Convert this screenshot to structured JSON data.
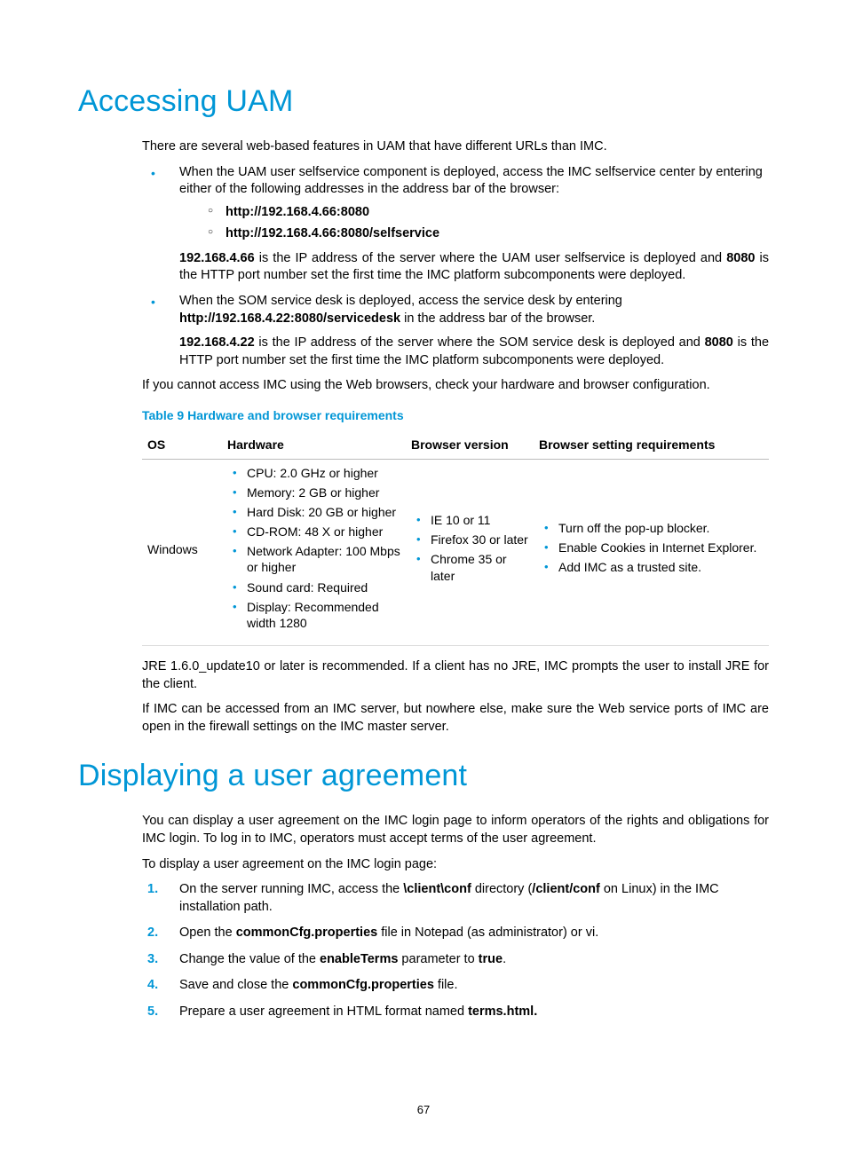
{
  "section1": {
    "heading": "Accessing UAM",
    "intro": "There are several web-based features in UAM that have different URLs than IMC.",
    "bullets": [
      {
        "text": "When the UAM user selfservice component is deployed, access the IMC selfservice center by entering either of the following addresses in the address bar of the browser:",
        "sub": [
          "http://192.168.4.66:8080",
          "http://192.168.4.66:8080/selfservice"
        ],
        "after_ip": "192.168.4.66",
        "after_mid": " is the IP address of the server where the UAM user selfservice is deployed and ",
        "after_port": "8080",
        "after_tail": " is the HTTP port number set the first time the IMC platform subcomponents were deployed."
      },
      {
        "text_pre": "When the SOM service desk is deployed, access the service desk by entering ",
        "text_bold": "http://192.168.4.22:8080/servicedesk",
        "text_post": " in the address bar of the browser.",
        "after_ip": "192.168.4.22",
        "after_mid": " is the IP address of the server where the SOM service desk is deployed and ",
        "after_port": "8080",
        "after_tail": " is the HTTP port number set the first time the IMC platform subcomponents were deployed."
      }
    ],
    "after_bullets": "If you cannot access IMC using the Web browsers, check your hardware and browser configuration.",
    "table_caption": "Table 9 Hardware and browser requirements",
    "table": {
      "headers": [
        "OS",
        "Hardware",
        "Browser version",
        "Browser setting requirements"
      ],
      "row": {
        "os": "Windows",
        "hardware": [
          "CPU: 2.0 GHz or higher",
          "Memory: 2 GB or higher",
          "Hard Disk: 20 GB or higher",
          "CD-ROM: 48 X or higher",
          "Network Adapter: 100 Mbps or higher",
          "Sound card: Required",
          "Display: Recommended width 1280"
        ],
        "browser": [
          "IE 10 or 11",
          "Firefox 30 or later",
          "Chrome 35 or later"
        ],
        "settings": [
          "Turn off the pop-up blocker.",
          "Enable Cookies in Internet Explorer.",
          "Add IMC as a trusted site."
        ]
      }
    },
    "para_jre": "JRE 1.6.0_update10 or later is recommended. If a client has no JRE, IMC prompts the user to install JRE for the client.",
    "para_firewall": "If IMC can be accessed from an IMC server, but nowhere else, make sure the Web service ports of IMC are open in the firewall settings on the IMC master server."
  },
  "section2": {
    "heading": "Displaying a user agreement",
    "intro": "You can display a user agreement on the IMC login page to inform operators of the rights and obligations for IMC login. To log in to IMC, operators must accept terms of the user agreement.",
    "lead": "To display a user agreement on the IMC login page:",
    "steps": [
      {
        "pre": "On the server running IMC, access the ",
        "b1": "\\client\\conf",
        "mid": " directory (",
        "b2": "/client/conf",
        "post": " on Linux) in the IMC installation path."
      },
      {
        "pre": "Open the ",
        "b1": "commonCfg.properties",
        "post": " file in Notepad (as administrator) or vi."
      },
      {
        "pre": "Change the value of the ",
        "b1": "enableTerms",
        "mid": " parameter to ",
        "b2": "true",
        "post": "."
      },
      {
        "pre": "Save and close the ",
        "b1": "commonCfg.properties",
        "post": " file."
      },
      {
        "pre": "Prepare a user agreement in HTML format named ",
        "b1": "terms.html.",
        "post": ""
      }
    ]
  },
  "page_number": "67"
}
